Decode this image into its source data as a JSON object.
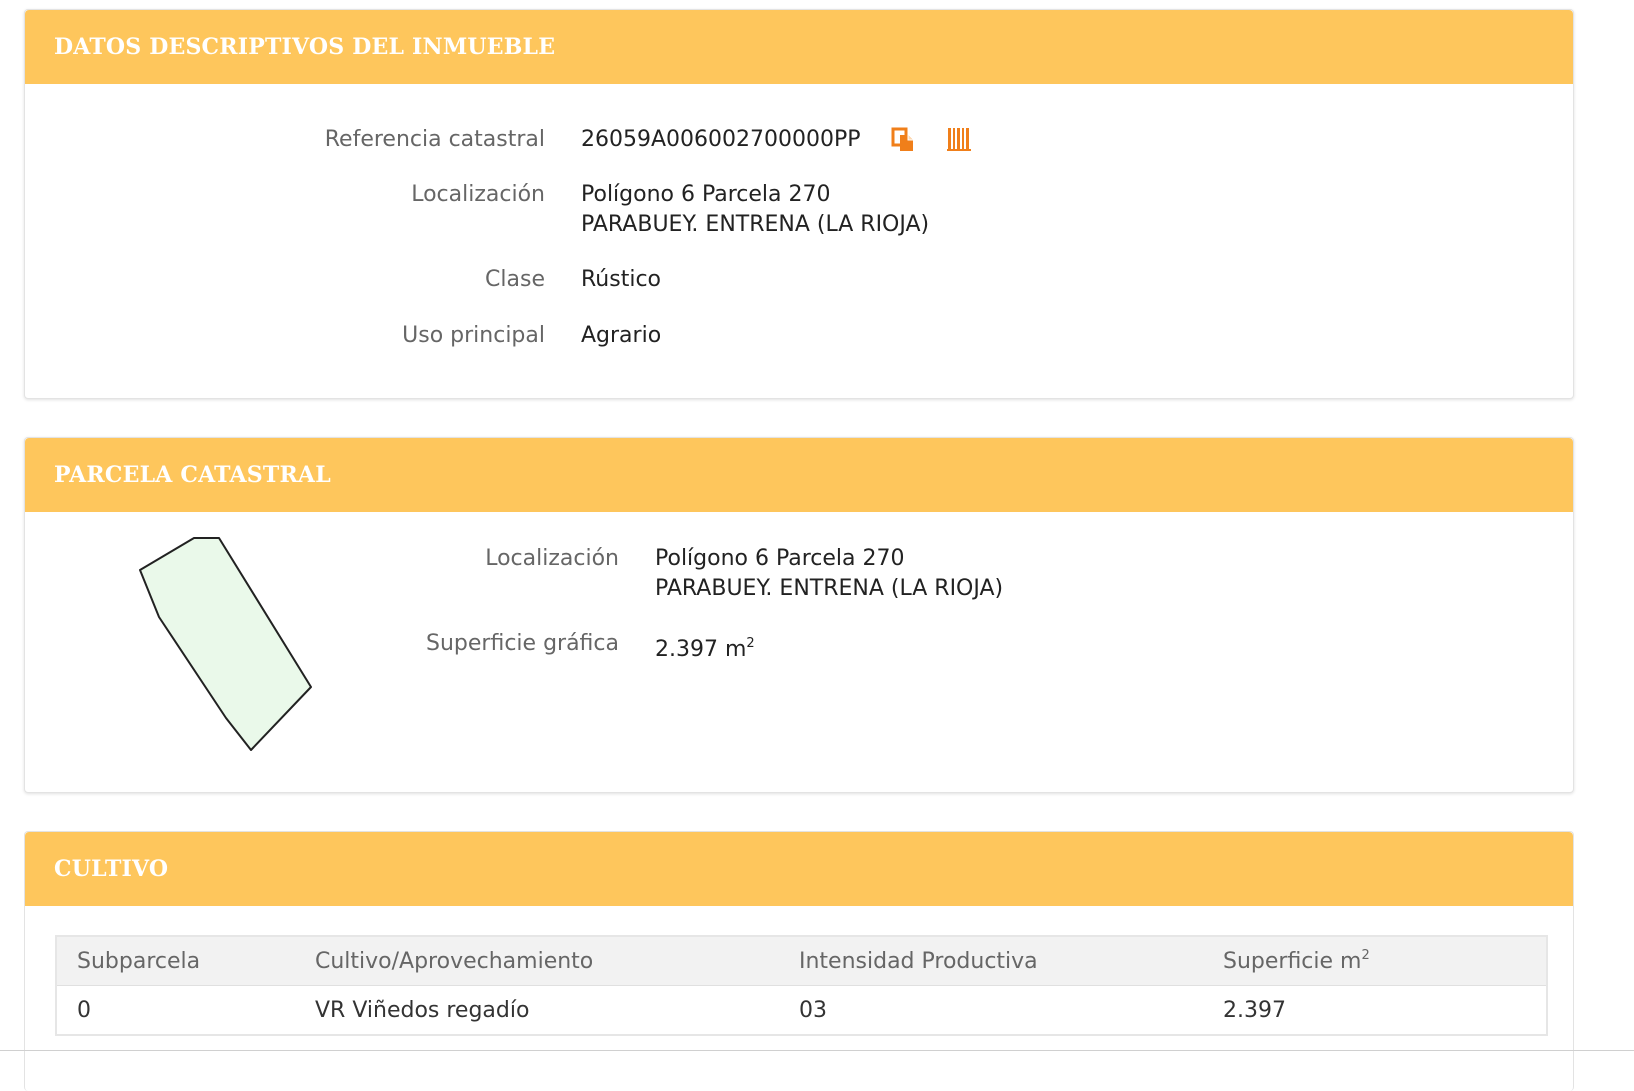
{
  "panel_descriptivos": {
    "title": "DATOS DESCRIPTIVOS DEL INMUEBLE",
    "referencia_label": "Referencia catastral",
    "referencia_value": "26059A006002700000PP",
    "localizacion_label": "Localización",
    "localizacion_line1": "Polígono 6 Parcela 270",
    "localizacion_line2": "PARABUEY. ENTRENA (LA RIOJA)",
    "clase_label": "Clase",
    "clase_value": "Rústico",
    "uso_label": "Uso principal",
    "uso_value": "Agrario"
  },
  "panel_parcela": {
    "title": "PARCELA CATASTRAL",
    "localizacion_label": "Localización",
    "localizacion_line1": "Polígono 6 Parcela 270",
    "localizacion_line2": "PARABUEY. ENTRENA (LA RIOJA)",
    "superficie_label": "Superficie gráfica",
    "superficie_value": "2.397 m",
    "superficie_unit_sup": "2"
  },
  "panel_cultivo": {
    "title": "CULTIVO",
    "columns": [
      "Subparcela",
      "Cultivo/Aprovechamiento",
      "Intensidad Productiva",
      "Superficie m"
    ],
    "column_sup": "2",
    "rows": [
      [
        "0",
        "VR Viñedos regadío",
        "03",
        "2.397"
      ]
    ]
  },
  "colors": {
    "header_bg": "#fec65c",
    "header_text": "#ffffff",
    "icon_accent": "#f07f1a",
    "parcel_fill": "#eaf9ea"
  },
  "icons": {
    "copy": "copy-icon",
    "barcode": "barcode-icon"
  }
}
